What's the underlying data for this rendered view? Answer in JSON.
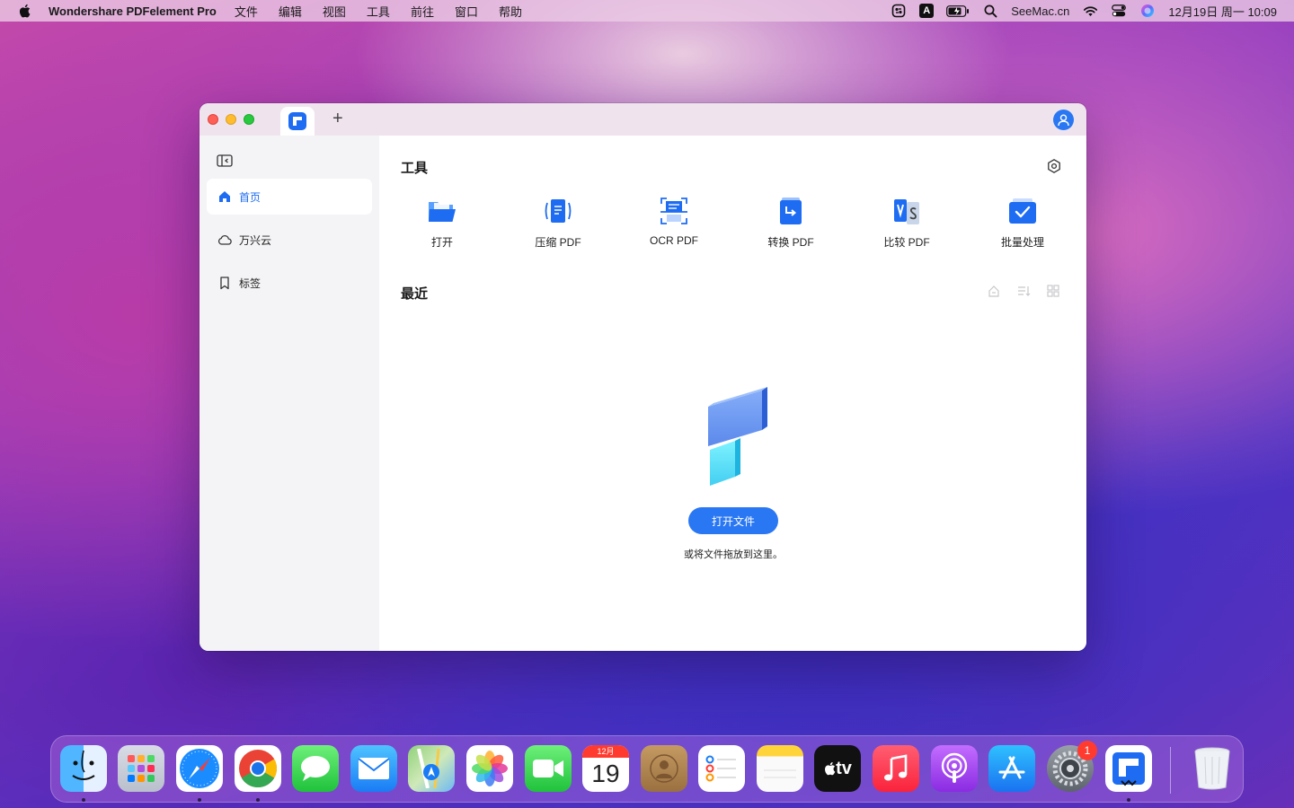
{
  "menubar": {
    "app_name": "Wondershare PDFelement Pro",
    "menus": [
      "文件",
      "编辑",
      "视图",
      "工具",
      "前往",
      "窗口",
      "帮助"
    ],
    "status": {
      "input_source": "A",
      "site_label": "SeeMac.cn",
      "clock": "12月19日 周一  10:09"
    }
  },
  "window": {
    "add_tab_label": "+",
    "sidebar": {
      "items": [
        {
          "label": "首页",
          "icon": "home-icon",
          "active": true
        },
        {
          "label": "万兴云",
          "icon": "cloud-icon",
          "active": false
        },
        {
          "label": "标签",
          "icon": "bookmark-icon",
          "active": false
        }
      ]
    },
    "main": {
      "tools_title": "工具",
      "tools": [
        {
          "label": "打开",
          "icon": "open-folder-icon"
        },
        {
          "label": "压缩 PDF",
          "icon": "compress-pdf-icon"
        },
        {
          "label": "OCR PDF",
          "icon": "ocr-pdf-icon"
        },
        {
          "label": "转换 PDF",
          "icon": "convert-pdf-icon"
        },
        {
          "label": "比较 PDF",
          "icon": "compare-pdf-icon"
        },
        {
          "label": "批量处理",
          "icon": "batch-process-icon"
        }
      ],
      "recent_title": "最近",
      "open_file_button": "打开文件",
      "drop_hint": "或将文件拖放到这里。"
    }
  },
  "dock": {
    "apps": [
      "Finder",
      "Launchpad",
      "Safari",
      "Chrome",
      "Messages",
      "Mail",
      "Maps",
      "Photos",
      "FaceTime",
      "Calendar",
      "Contacts",
      "Reminders",
      "Notes",
      "TV",
      "Music",
      "Podcasts",
      "App Store",
      "System Preferences",
      "PDFelement",
      "Trash"
    ],
    "calendar": {
      "month": "12月",
      "day": "19"
    },
    "tv_label": "tv",
    "settings_badge": "1"
  },
  "colors": {
    "accent": "#2a77f3",
    "sidebar_bg": "#f4f4f6",
    "titlebar_bg": "#efe4ee"
  }
}
